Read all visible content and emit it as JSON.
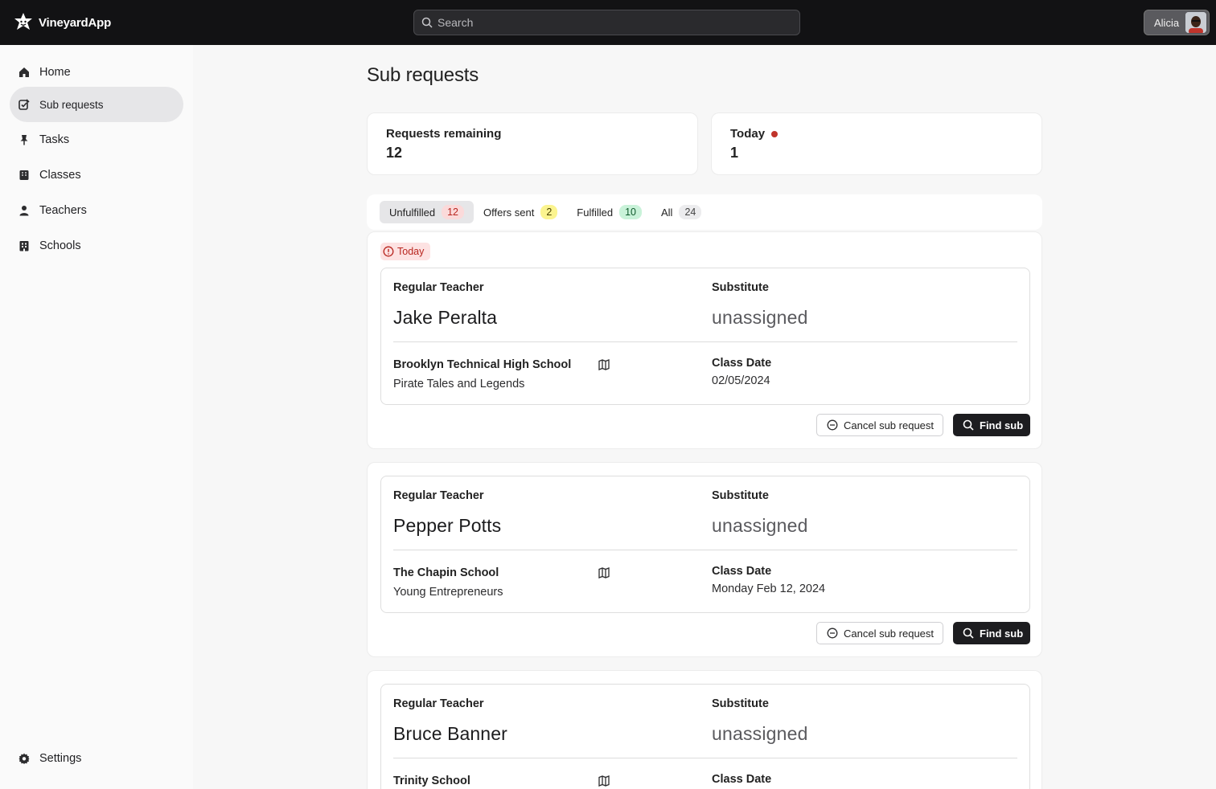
{
  "app": {
    "name": "VineyardApp"
  },
  "search": {
    "placeholder": "Search"
  },
  "user": {
    "name": "Alicia"
  },
  "sidebar": {
    "items": [
      {
        "label": "Home",
        "icon": "home-icon"
      },
      {
        "label": "Sub requests",
        "icon": "edit-check-icon",
        "active": true
      },
      {
        "label": "Tasks",
        "icon": "pin-icon"
      },
      {
        "label": "Classes",
        "icon": "book-icon"
      },
      {
        "label": "Teachers",
        "icon": "person-icon"
      },
      {
        "label": "Schools",
        "icon": "building-icon"
      }
    ],
    "settings": {
      "label": "Settings",
      "icon": "gear-icon"
    }
  },
  "page": {
    "title": "Sub requests"
  },
  "stats": [
    {
      "label": "Requests remaining",
      "value": "12"
    },
    {
      "label": "Today",
      "value": "1",
      "indicator_color": "#c0342b"
    }
  ],
  "tabs": [
    {
      "label": "Unfulfilled",
      "count": "12",
      "badge_bg": "#fbdada",
      "badge_color": "#b8261f",
      "active": true
    },
    {
      "label": "Offers sent",
      "count": "2",
      "badge_bg": "#fbf48f",
      "badge_color": "#4a4300"
    },
    {
      "label": "Fulfilled",
      "count": "10",
      "badge_bg": "#c9f2d9",
      "badge_color": "#0f5a2c"
    },
    {
      "label": "All",
      "count": "24",
      "badge_bg": "#ececee",
      "badge_color": "#444"
    }
  ],
  "labels": {
    "today_tag": "Today",
    "regular_teacher": "Regular Teacher",
    "substitute": "Substitute",
    "class_date": "Class Date",
    "cancel_button": "Cancel sub request",
    "find_button": "Find sub"
  },
  "requests": [
    {
      "teacher": "Jake Peralta",
      "substitute": "unassigned",
      "school": "Brooklyn Technical High School",
      "class_name": "Pirate Tales and Legends",
      "date": "02/05/2024",
      "today": true
    },
    {
      "teacher": "Pepper Potts",
      "substitute": "unassigned",
      "school": "The Chapin School",
      "class_name": "Young Entrepreneurs",
      "date": "Monday Feb 12, 2024"
    },
    {
      "teacher": "Bruce Banner",
      "substitute": "unassigned",
      "school": "Trinity School",
      "class_name": "",
      "date": ""
    }
  ]
}
